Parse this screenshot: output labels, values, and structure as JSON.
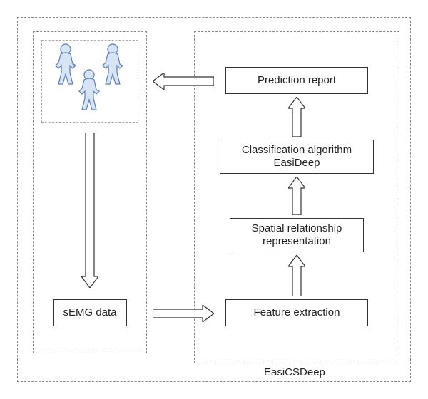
{
  "diagram": {
    "title_label": "EasiCSDeep",
    "boxes": {
      "prediction": "Prediction report",
      "classification_line1": "Classification algorithm",
      "classification_line2": "EasiDeep",
      "spatial_line1": "Spatial relationship",
      "spatial_line2": "representation",
      "feature": "Feature  extraction",
      "semg": "sEMG data"
    }
  }
}
